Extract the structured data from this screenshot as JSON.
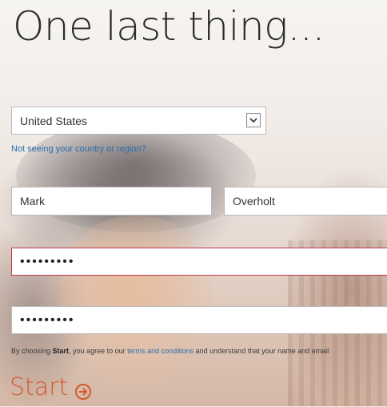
{
  "page": {
    "title": "One last thing..."
  },
  "form": {
    "country": {
      "value": "United States"
    },
    "country_help_link": "Not seeing your country or region?",
    "first_name": {
      "value": "Mark"
    },
    "last_name": {
      "value": "Overholt"
    },
    "password": {
      "value": "•••••••••"
    },
    "confirm_password": {
      "value": "•••••••••"
    },
    "terms": {
      "prefix": "By choosing ",
      "start_word": "Start",
      "middle": ", you agree to our ",
      "link": "terms and conditions",
      "suffix": " and understand that your name and email"
    },
    "start_label": "Start"
  },
  "colors": {
    "accent": "#d4582e",
    "link": "#2a6eb0",
    "error_border": "#c53a4a"
  },
  "icons": {
    "select_chevron": "chevron-down-icon",
    "start_arrow": "arrow-circle-right-icon"
  }
}
